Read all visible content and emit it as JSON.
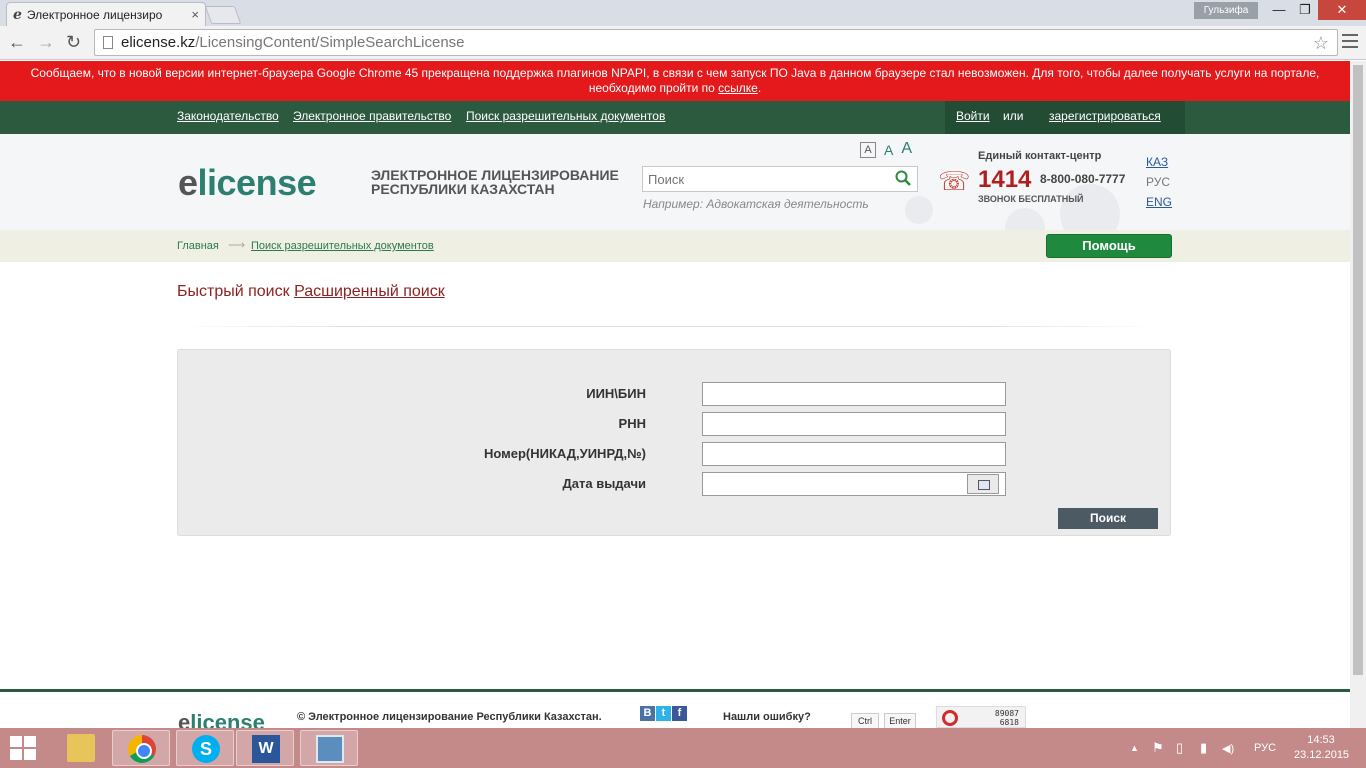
{
  "browser": {
    "tab_title": "Электронное лицензиро",
    "tab_close": "×",
    "favicon": "e",
    "user_badge": "Гульзифа",
    "win_min": "—",
    "win_max": "❐",
    "win_close": "✕",
    "url_host": "elicense.kz",
    "url_path": "/LicensingContent/SimpleSearchLicense",
    "nav_back": "←",
    "nav_forward": "→",
    "nav_reload": "↻",
    "star": "☆"
  },
  "warning": {
    "text": "Сообщаем, что в новой версии интернет-браузера Google Chrome 45 прекращена поддержка плагинов NPAPI, в связи с чем запуск ПО Java в данном браузере стал невозможен. Для того, чтобы далее получать услуги на портале, необходимо пройти по ",
    "link": "ссылке",
    "suffix": "."
  },
  "topnav": {
    "legislation": "Законодательство",
    "egov": "Электронное правительство",
    "permits_search": "Поиск разрешительных документов",
    "login": "Войти",
    "or": "или",
    "register": "зарегистрироваться"
  },
  "header": {
    "logo_e": "e",
    "logo_rest": "license",
    "title_line1": "ЭЛЕКТРОННОЕ ЛИЦЕНЗИРОВАНИЕ",
    "title_line2": "РЕСПУБЛИКИ КАЗАХСТАН",
    "font_small": "A",
    "font_medium": "A",
    "font_large": "A",
    "search_placeholder": "Поиск",
    "search_hint": "Например: Адвокатская деятельность",
    "contact_label": "Единый контакт-центр",
    "contact_number": "1414",
    "contact_phone": "8-800-080-7777",
    "contact_free": "ЗВОНОК БЕСПЛАТНЫЙ",
    "lang_kaz": "КАЗ",
    "lang_rus": "РУС",
    "lang_eng": "ENG"
  },
  "breadcrumbs": {
    "home": "Главная",
    "arrow": "⟶",
    "current": "Поиск разрешительных документов",
    "help": "Помощь"
  },
  "search_modes": {
    "quick": "Быстрый поиск",
    "advanced": "Расширенный поиск"
  },
  "form": {
    "fields": [
      {
        "label": "ИИН\\БИН",
        "value": ""
      },
      {
        "label": "РНН",
        "value": ""
      },
      {
        "label": "Номер(НИКАД,УИНРД,№)",
        "value": ""
      },
      {
        "label": "Дата выдачи",
        "value": ""
      }
    ],
    "submit": "Поиск"
  },
  "footer": {
    "logo_e": "e",
    "logo_rest": "license",
    "copyright": "© Электронное лицензирование Республики Казахстан.",
    "social_vk": "B",
    "social_tw": "t",
    "social_fb": "f",
    "error_label": "Нашли ошибку?",
    "key_ctrl": "Ctrl",
    "key_enter": "Enter",
    "counter_line1": "89087",
    "counter_line2": "6818"
  },
  "taskbar": {
    "skype": "S",
    "word": "W",
    "tray_arrow": "▲",
    "tray_flag": "⚑",
    "tray_battery": "▯",
    "tray_signal": "▮",
    "tray_volume": "◀)",
    "lang": "РУС",
    "time": "14:53",
    "date": "23.12.2015"
  }
}
